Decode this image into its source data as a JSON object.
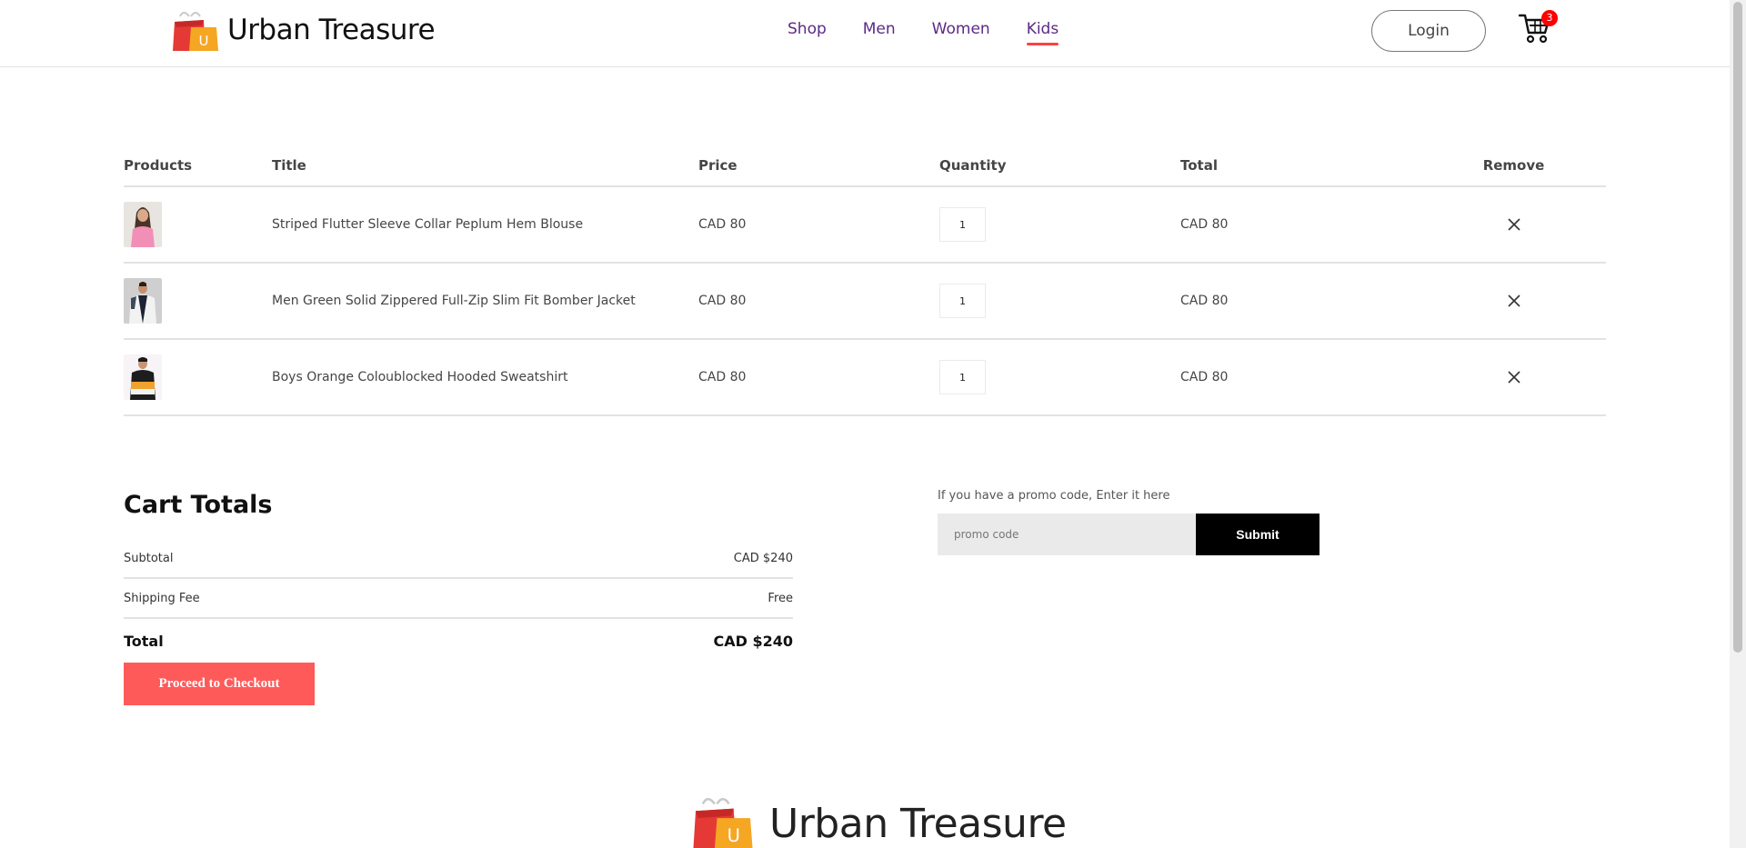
{
  "header": {
    "brand": "Urban Treasure",
    "nav": [
      {
        "label": "Shop"
      },
      {
        "label": "Men"
      },
      {
        "label": "Women"
      },
      {
        "label": "Kids"
      }
    ],
    "active_nav": "Kids",
    "login_label": "Login",
    "cart_count": "3",
    "accent_color": "#ff4141",
    "nav_color": "#5b2a86"
  },
  "cart": {
    "columns": [
      "Products",
      "Title",
      "Price",
      "Quantity",
      "Total",
      "Remove"
    ],
    "items": [
      {
        "thumb_icon": "product-photo-woman-pink-blouse",
        "title": "Striped Flutter Sleeve Collar Peplum Hem Blouse",
        "price": "CAD 80",
        "quantity": "1",
        "total": "CAD 80"
      },
      {
        "thumb_icon": "product-photo-man-bomber-jacket",
        "title": "Men Green Solid Zippered Full-Zip Slim Fit Bomber Jacket",
        "price": "CAD 80",
        "quantity": "1",
        "total": "CAD 80"
      },
      {
        "thumb_icon": "product-photo-boy-sweatshirt",
        "title": "Boys Orange Coloublocked Hooded Sweatshirt",
        "price": "CAD 80",
        "quantity": "1",
        "total": "CAD 80"
      }
    ]
  },
  "totals": {
    "title": "Cart Totals",
    "subtotal_label": "Subtotal",
    "subtotal_value": "CAD $240",
    "shipping_label": "Shipping Fee",
    "shipping_value": "Free",
    "total_label": "Total",
    "total_value": "CAD $240",
    "checkout_label": "Proceed to Checkout",
    "checkout_color": "#ff5a5a"
  },
  "promo": {
    "label": "If you have a promo code, Enter it here",
    "placeholder": "promo code",
    "submit_label": "Submit"
  },
  "footer": {
    "brand": "Urban Treasure"
  }
}
